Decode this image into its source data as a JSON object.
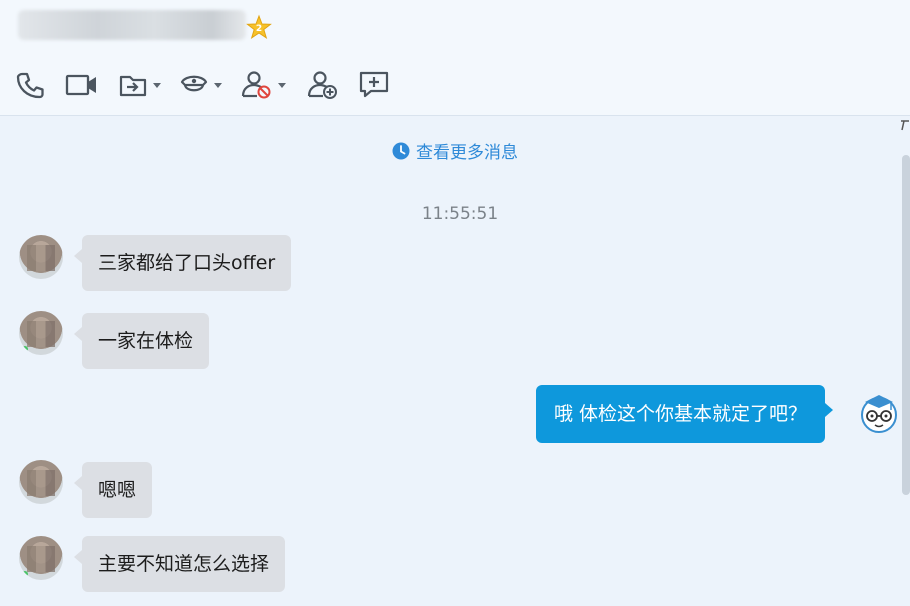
{
  "header": {
    "contact_name": "",
    "star_icon": "star-icon"
  },
  "toolbar": {
    "buttons": [
      {
        "name": "voice-call-button",
        "icon": "phone-icon"
      },
      {
        "name": "video-call-button",
        "icon": "video-camera-icon"
      },
      {
        "name": "file-transfer-button",
        "icon": "file-transfer-icon",
        "dropdown": true
      },
      {
        "name": "remote-assist-button",
        "icon": "police-hat-icon",
        "dropdown": true
      },
      {
        "name": "block-user-button",
        "icon": "user-block-icon",
        "dropdown": true
      },
      {
        "name": "add-friend-button",
        "icon": "user-add-icon"
      },
      {
        "name": "new-chat-button",
        "icon": "chat-add-icon"
      }
    ]
  },
  "chat": {
    "more_messages": "查看更多消息",
    "timestamp": "11:55:51",
    "messages": [
      {
        "from": "contact",
        "text": "三家都给了口头offer"
      },
      {
        "from": "contact",
        "text": "一家在体检"
      },
      {
        "from": "self",
        "text": "哦  体检这个你基本就定了吧？"
      },
      {
        "from": "contact",
        "text": "嗯嗯"
      },
      {
        "from": "contact",
        "text": "主要不知道怎么选择"
      }
    ]
  },
  "colors": {
    "accent": "#0e98dc",
    "link": "#2f8ad8",
    "incoming_bubble": "#dcdfe4",
    "background": "#ecf3fb"
  }
}
